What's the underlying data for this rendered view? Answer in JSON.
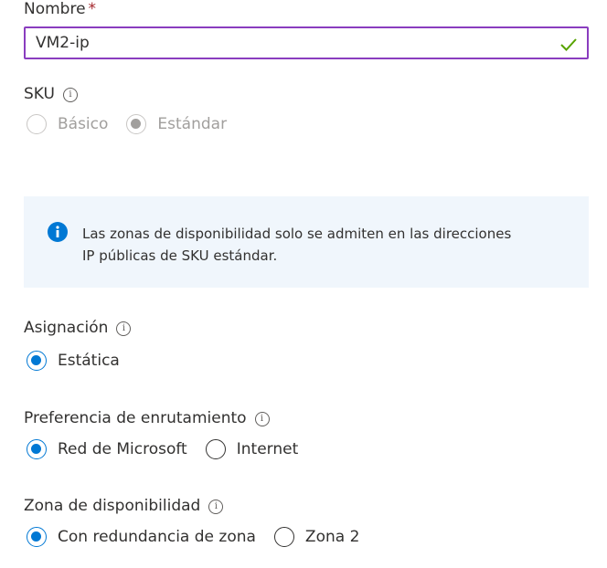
{
  "name_field": {
    "label": "Nombre",
    "required_marker": "*",
    "value": "VM2-ip",
    "valid_icon": "checkmark-icon"
  },
  "sku": {
    "label": "SKU",
    "info_icon": "info-icon",
    "options": [
      {
        "label": "Básico",
        "checked": false,
        "disabled": true
      },
      {
        "label": "Estándar",
        "checked": true,
        "disabled": true
      }
    ]
  },
  "info_banner": {
    "icon": "info-filled-icon",
    "line1": "Las zonas de disponibilidad solo se admiten en las direcciones",
    "line2": "IP públicas de SKU estándar."
  },
  "assignment": {
    "label": "Asignación",
    "info_icon": "info-icon",
    "options": [
      {
        "label": "Estática",
        "checked": true
      }
    ]
  },
  "routing": {
    "label": "Preferencia de enrutamiento",
    "info_icon": "info-icon",
    "options": [
      {
        "label": "Red de Microsoft",
        "checked": true
      },
      {
        "label": "Internet",
        "checked": false
      }
    ]
  },
  "availability_zone": {
    "label": "Zona de disponibilidad",
    "info_icon": "info-icon",
    "options": [
      {
        "label": "Con redundancia de zona",
        "checked": true
      },
      {
        "label": "Zona 2",
        "checked": false
      }
    ]
  },
  "colors": {
    "accent": "#0078d4",
    "focus_border": "#8a3dbf",
    "valid_check": "#57a300",
    "info_bg": "#f0f6fc"
  }
}
